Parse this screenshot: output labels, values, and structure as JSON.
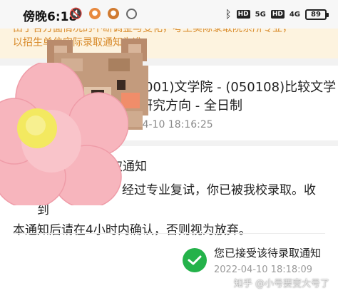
{
  "status_bar": {
    "time": "傍晚6:18",
    "hd1": "HD",
    "signal1": "5G",
    "hd2": "HD",
    "signal2": "4G",
    "battery": "89"
  },
  "notice": {
    "line1": "由于各方面情况的不断调整与变化，考生实际录取院系所专业，",
    "line2": "以招生单位实际录取通知为准。"
  },
  "card1": {
    "title_line1": "(001)文学院 - (050108)比较文学",
    "title_line2": "研究方向 - 全日制",
    "time": "2022-04-10 18:16:25"
  },
  "card2": {
    "heading": "录取通知",
    "body_line1": "考生　　　　　经过专业复试，你已被我校录取。收到",
    "body_line2": "本通知后请在4小时内确认，否则视为放弃。",
    "accepted_text": "您已接受该待录取通知",
    "accepted_time": "2022-04-10 18:18:09"
  },
  "watermark": "知乎 @小号要变大号了",
  "colors": {
    "notice_bg": "#fdf3df",
    "notice_text": "#d88a2a",
    "success_green": "#24b24a",
    "flower_pink": "#f7b5bd",
    "flower_center": "#f3e960"
  },
  "icons": [
    "mute-icon",
    "app-icon",
    "app-icon",
    "ring-icon",
    "bluetooth-icon",
    "battery-icon",
    "check-icon",
    "bear-sticker",
    "flower-sticker"
  ]
}
